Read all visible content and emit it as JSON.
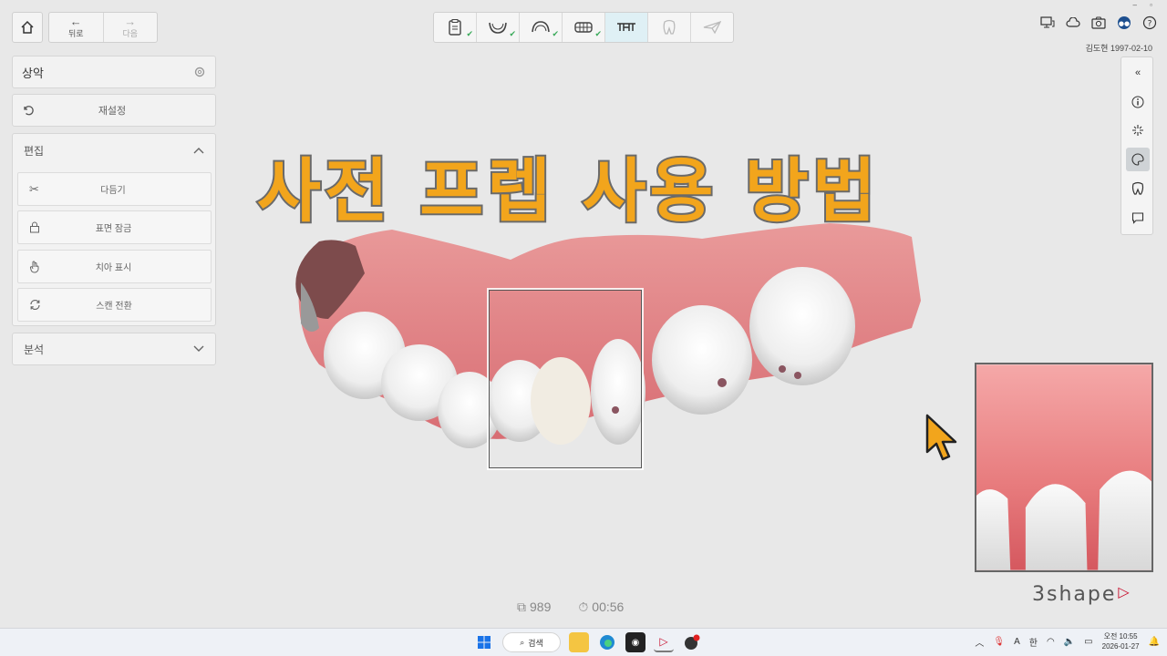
{
  "nav": {
    "back_label": "뒤로",
    "next_label": "다음"
  },
  "left_panel": {
    "arch_label": "상악",
    "reset_label": "재설정",
    "edit_header": "편집",
    "tools": [
      {
        "label": "다듬기",
        "icon": "scissors-icon"
      },
      {
        "label": "표면 잠금",
        "icon": "lock-icon"
      },
      {
        "label": "치아 표시",
        "icon": "hand-icon"
      },
      {
        "label": "스캔 전환",
        "icon": "refresh-icon"
      }
    ],
    "analysis_header": "분석"
  },
  "patient": {
    "name_date": "김도현 1997-02-10"
  },
  "headline": "사전 프렙 사용 방법",
  "stats": {
    "count": "989",
    "time": "00:56"
  },
  "brand": "3shape",
  "taskbar": {
    "search_label": "검색",
    "tray_a": "A",
    "tray_ime": "한",
    "clock_time": "오전 10:55",
    "clock_date": "2026-01-27"
  },
  "colors": {
    "headline": "#f2a51c",
    "brand_accent": "#c8102e",
    "check": "#3aaa5a"
  }
}
